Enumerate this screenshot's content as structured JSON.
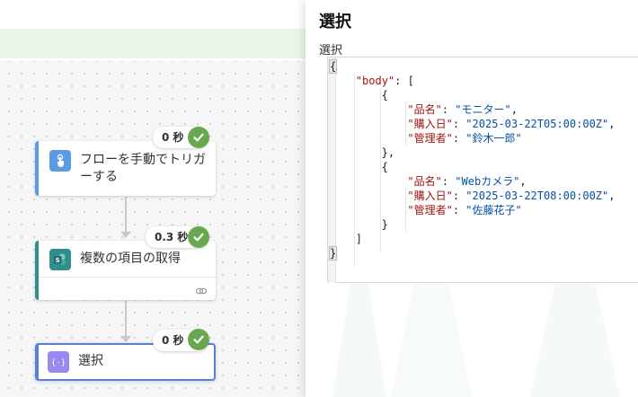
{
  "flow": {
    "steps": [
      {
        "title": "フローを手動でトリガーする",
        "duration": "0 秒",
        "icon": "hand-touch-icon",
        "status": "succeeded"
      },
      {
        "title": "複数の項目の取得",
        "duration": "0.3 秒",
        "icon": "sharepoint-icon",
        "status": "succeeded"
      },
      {
        "title": "選択",
        "duration": "0 秒",
        "icon": "select-data-operation-icon",
        "status": "succeeded"
      }
    ],
    "link_icon": "link-icon"
  },
  "panel": {
    "title": "選択",
    "output_label": "選択",
    "json_lines": [
      "{",
      "  \"body\": [",
      "    {",
      "      \"品名\": \"モニター\",",
      "      \"購入日\": \"2025-03-22T05:00:00Z\",",
      "      \"管理者\": \"鈴木一郎\"",
      "    },",
      "    {",
      "      \"品名\": \"Webカメラ\",",
      "      \"購入日\": \"2025-03-22T08:00:00Z\",",
      "      \"管理者\": \"佐藤花子\"",
      "    }",
      "  ]",
      "}"
    ]
  },
  "colors": {
    "success": "#6aa84f",
    "trigger_accent": "#5b9be6",
    "sharepoint_accent": "#2f8f8c",
    "select_accent": "#5b7fd6",
    "json_key": "#a31515",
    "json_value": "#0451a5"
  }
}
